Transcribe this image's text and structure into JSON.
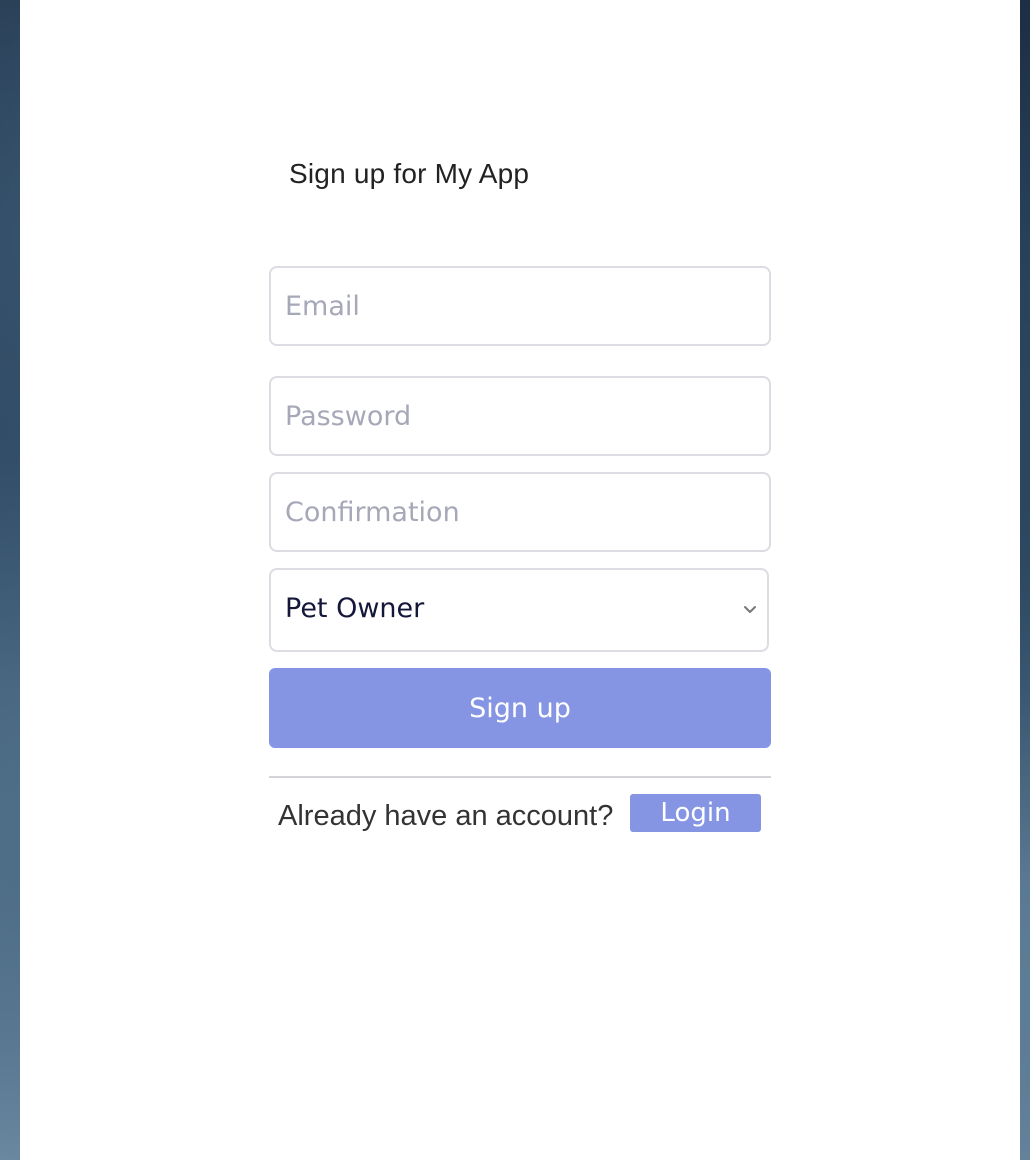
{
  "form": {
    "title": "Sign up for My App",
    "email_placeholder": "Email",
    "password_placeholder": "Password",
    "confirmation_placeholder": "Confirmation",
    "role_selected": "Pet Owner",
    "submit_label": "Sign up"
  },
  "footer": {
    "prompt": "Already have an account?",
    "login_label": "Login"
  },
  "colors": {
    "accent": "#8595e4",
    "input_border": "#dcdce2",
    "placeholder": "#a6a8b8"
  },
  "icons": {
    "select": "chevron-down-icon"
  }
}
